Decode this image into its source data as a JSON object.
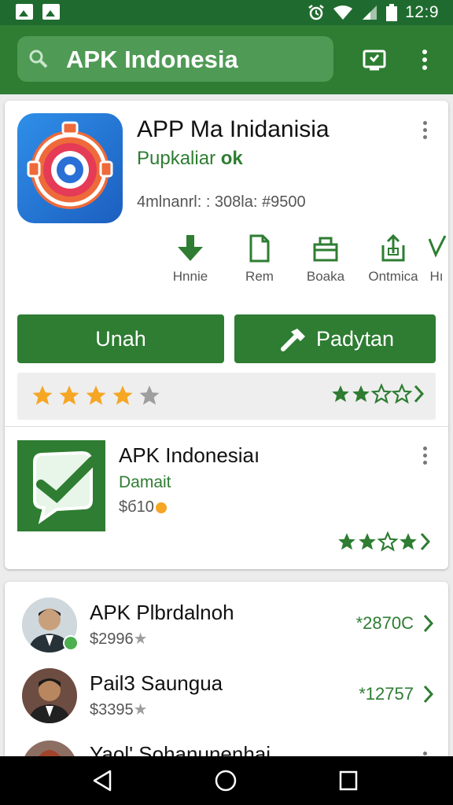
{
  "status_bar": {
    "time": "12:9"
  },
  "search": {
    "text": "APK Indonesia"
  },
  "app": {
    "title": "APP Ma Inidanisia",
    "subtitle": "Pupkaliar",
    "subtitle_badge": "ok",
    "meta": "4mlnanrl: : 308la: #9500"
  },
  "actions": [
    {
      "label": "Hnnie"
    },
    {
      "label": "Rem"
    },
    {
      "label": "Boaka"
    },
    {
      "label": "Ontmica"
    },
    {
      "label": "Hı"
    }
  ],
  "buttons": {
    "primary": "Unah",
    "secondary": "Padytan"
  },
  "rating_row": {
    "left_stars": 4,
    "right_stars": 2.5
  },
  "app2": {
    "title": "APK Indonesiaı",
    "subtitle": "Damait",
    "price": "$б10",
    "stars": 3.5
  },
  "list": [
    {
      "title": "APK Plbrdalnoh",
      "price": "$2996",
      "value": "*2870C"
    },
    {
      "title": "Pail3 Saungua",
      "price": "$3395",
      "value": "*12757"
    },
    {
      "title": "Yaol' Sohanunenhai",
      "price": "",
      "value": ""
    }
  ],
  "colors": {
    "brand": "#2e7d32",
    "status": "#1f6b2f",
    "star": "#f5a623"
  }
}
